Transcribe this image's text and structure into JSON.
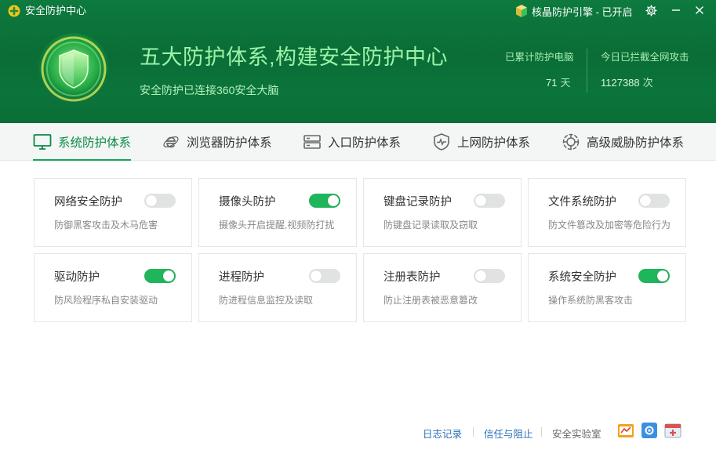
{
  "window": {
    "title": "安全防护中心",
    "engine_label": "核晶防护引擎 - 已开启"
  },
  "hero": {
    "headline": "五大防护体系,构建安全防护中心",
    "subline": "安全防护已连接360安全大脑",
    "stats": [
      {
        "label": "已累计防护电脑",
        "value": "71",
        "unit": "天"
      },
      {
        "label": "今日已拦截全网攻击",
        "value": "1127388",
        "unit": "次"
      }
    ]
  },
  "tabs": [
    {
      "label": "系统防护体系",
      "icon": "monitor-icon",
      "active": true
    },
    {
      "label": "浏览器防护体系",
      "icon": "browser-icon",
      "active": false
    },
    {
      "label": "入口防护体系",
      "icon": "server-icon",
      "active": false
    },
    {
      "label": "上网防护体系",
      "icon": "shield-pulse-icon",
      "active": false
    },
    {
      "label": "高级威胁防护体系",
      "icon": "radar-icon",
      "active": false
    }
  ],
  "cards": [
    {
      "title": "网络安全防护",
      "desc": "防御黑客攻击及木马危害",
      "enabled": false
    },
    {
      "title": "摄像头防护",
      "desc": "摄像头开启提醒,视频防打扰",
      "enabled": true
    },
    {
      "title": "键盘记录防护",
      "desc": "防键盘记录读取及窃取",
      "enabled": false
    },
    {
      "title": "文件系统防护",
      "desc": "防文件篡改及加密等危险行为",
      "enabled": false
    },
    {
      "title": "驱动防护",
      "desc": "防风险程序私自安装驱动",
      "enabled": true
    },
    {
      "title": "进程防护",
      "desc": "防进程信息监控及读取",
      "enabled": false
    },
    {
      "title": "注册表防护",
      "desc": "防止注册表被恶意篡改",
      "enabled": false
    },
    {
      "title": "系统安全防护",
      "desc": "操作系统防黑客攻击",
      "enabled": true
    }
  ],
  "footer": {
    "log_label": "日志记录",
    "trust_label": "信任与阻止",
    "lab_label": "安全实验室"
  },
  "colors": {
    "header_green": "#0a6d36",
    "accent_green": "#1fb55a",
    "link_blue": "#2a6fb8"
  }
}
